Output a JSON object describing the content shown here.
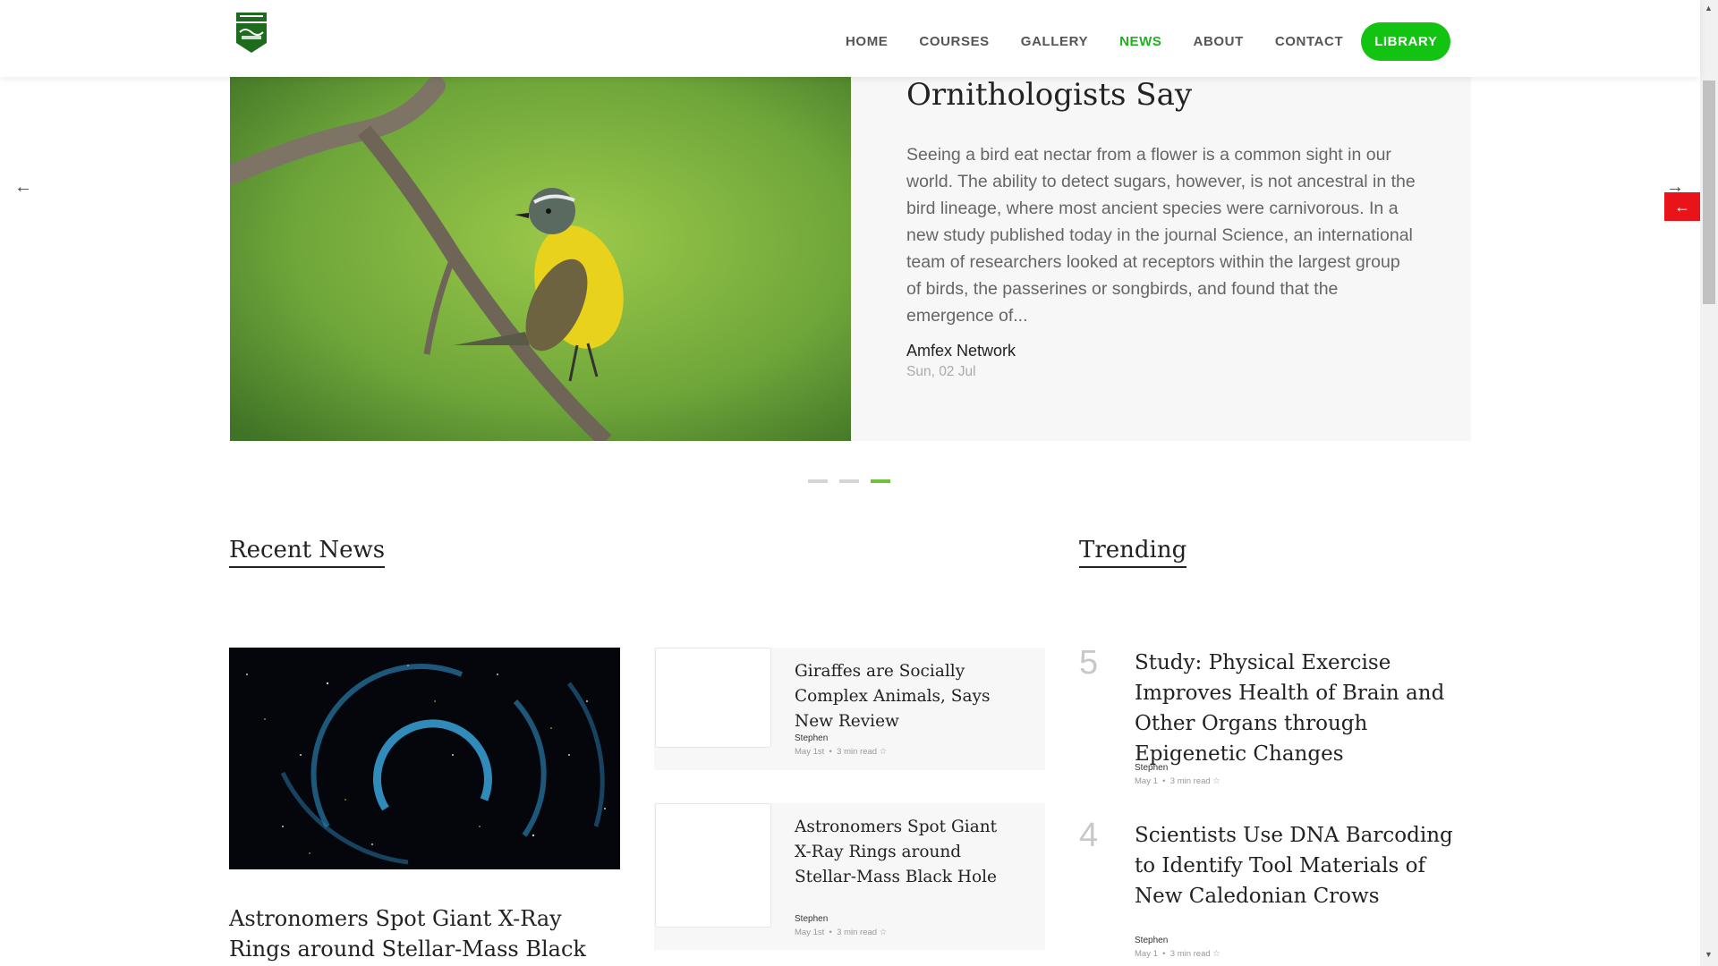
{
  "nav": {
    "items": [
      "HOME",
      "COURSES",
      "GALLERY",
      "NEWS",
      "ABOUT",
      "CONTACT"
    ],
    "active": "NEWS",
    "cta": "LIBRARY"
  },
  "slider": {
    "title": "Ornithologists Say",
    "text": "Seeing a bird eat nectar from a flower is a common sight in our world. The ability to detect sugars, however, is not ancestral in the bird lineage, where most ancient species were carnivorous. In a new study published today in the journal Science, an international team of researchers looked at receptors within the largest group of birds, the passerines or songbirds, and found that the emergence of...",
    "author": "Amfex Network",
    "date": "Sun, 02 Jul",
    "prev_icon": "arrow-left-icon",
    "next_icon": "arrow-right-icon",
    "active_dot": 3
  },
  "recent_news": {
    "heading": "Recent News",
    "featured": {
      "title": "Astronomers Spot Giant X-Ray Rings around Stellar-Mass Black Hole"
    },
    "cards": [
      {
        "title": "Giraffes are Socially Complex Animals, Says New Review",
        "author": "Stephen",
        "date": "May 1st",
        "read": "3 min read"
      },
      {
        "title": "Astronomers Spot Giant X-Ray Rings around Stellar-Mass Black Hole",
        "author": "Stephen",
        "date": "May 1st",
        "read": "3 min read"
      }
    ]
  },
  "trending": {
    "heading": "Trending",
    "items": [
      {
        "num": "5",
        "title": "Study: Physical Exercise Improves Health of Brain and Other Organs through Epigenetic Changes",
        "author": "Stephen",
        "date": "May 1",
        "read": "3 min read"
      },
      {
        "num": "4",
        "title": "Scientists Use DNA Barcoding to Identify Tool Materials of New Caledonian Crows",
        "author": "Stephen",
        "date": "May 1",
        "read": "3 min read"
      }
    ]
  },
  "colors": {
    "accent": "#12c312",
    "active_nav": "#1db31d",
    "red": "#e8141a"
  }
}
